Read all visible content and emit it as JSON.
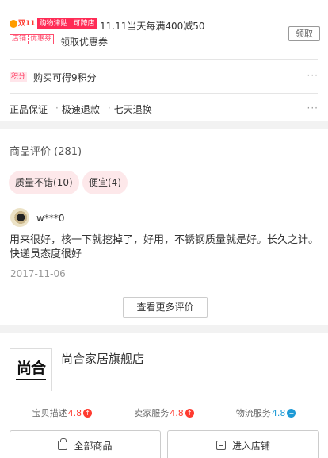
{
  "promo": {
    "badge_1111": "双11",
    "badge_subsidy": "购物津贴",
    "badge_crossstore": "可跨店",
    "promo_text": "11.11当天每满400减50",
    "coupon_tag_a": "店铺",
    "coupon_tag_b": "优惠券",
    "coupon_text": "领取优惠券",
    "claim_label": "领取",
    "points_tag": "积分",
    "points_text": "购买可得9积分",
    "more": "···",
    "guarantees": [
      "正品保证",
      "极速退款",
      "七天退换"
    ],
    "sep": "·"
  },
  "reviews": {
    "title": "商品评价 (281)",
    "tags": [
      "质量不错(10)",
      "便宜(4)"
    ],
    "username": "w***0",
    "text": "用来很好，核一下就挖掉了，好用，不锈钢质量就是好。长久之计。快递员态度很好",
    "date": "2017-11-06",
    "more_label": "查看更多评价"
  },
  "store": {
    "logo_text": "尚合",
    "name": "尚合家居旗舰店",
    "ratings": [
      {
        "label": "宝贝描述",
        "value": "4.8",
        "trend": "up",
        "color": "#ff3b30"
      },
      {
        "label": "卖家服务",
        "value": "4.8",
        "trend": "up",
        "color": "#ff3b30"
      },
      {
        "label": "物流服务",
        "value": "4.8",
        "trend": "flat",
        "color": "#1e9ad6"
      }
    ],
    "all_products_label": "全部商品",
    "enter_store_label": "进入店铺"
  },
  "icons": {
    "up_arrow": "↑",
    "flat": "−"
  }
}
